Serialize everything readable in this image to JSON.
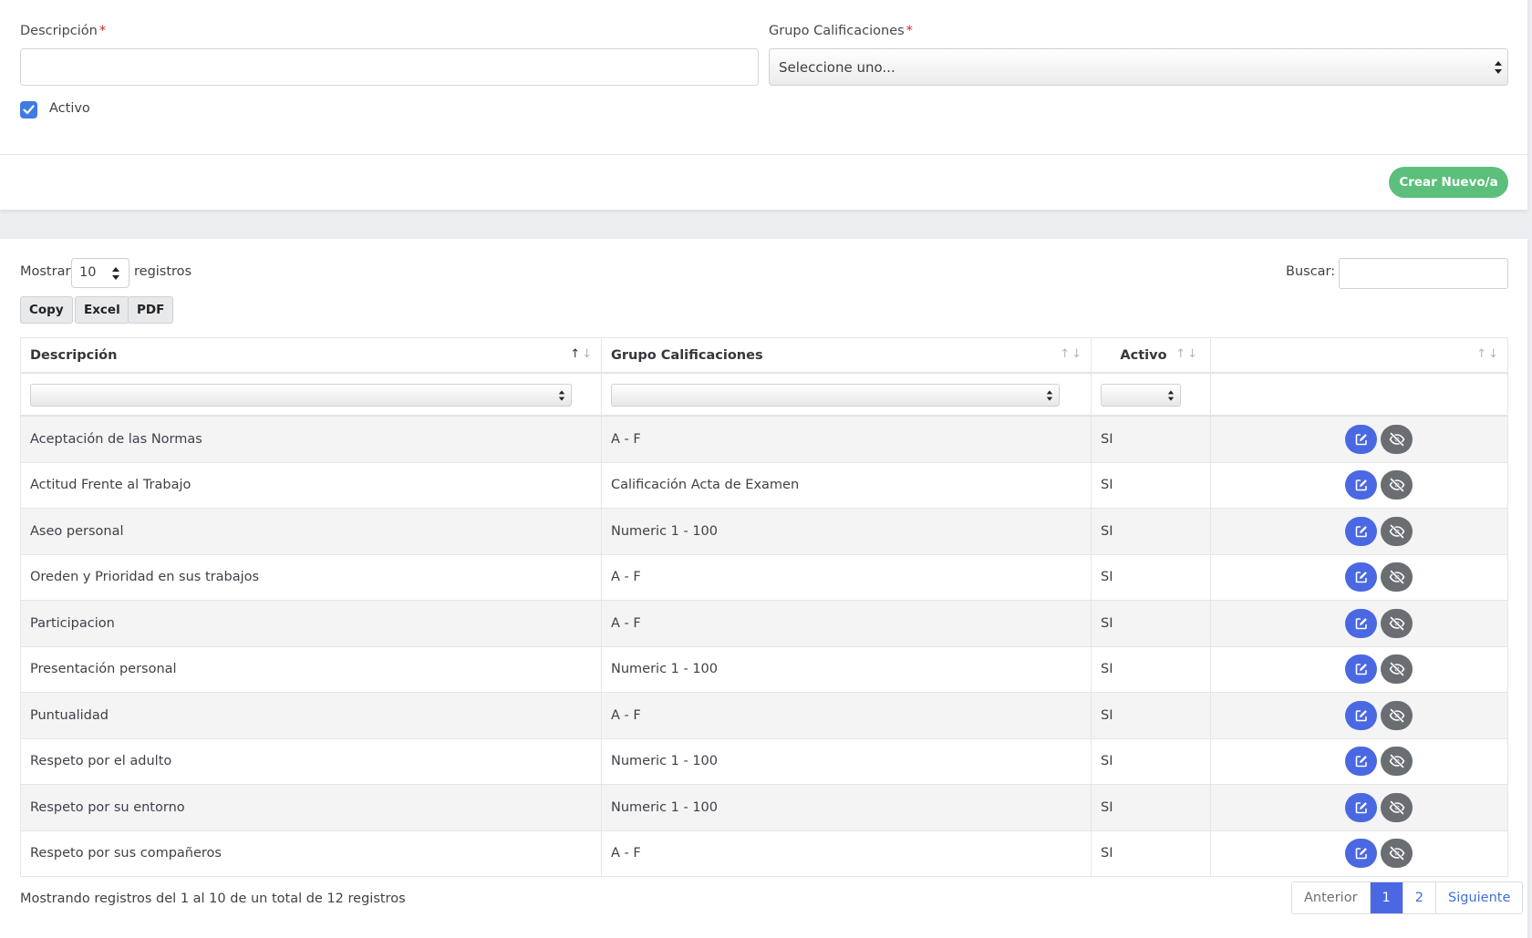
{
  "form": {
    "descripcion_label": "Descripción",
    "grupo_label": "Grupo Calificaciones",
    "required_mark": "*",
    "descripcion_value": "",
    "grupo_selected": "Seleccione uno...",
    "activo_label": "Activo",
    "activo_checked": true,
    "create_button": "Crear Nuevo/a"
  },
  "controls": {
    "show_label": "Mostrar",
    "page_length": "10",
    "records_label": "registros",
    "search_label": "Buscar:",
    "search_value": "",
    "export_buttons": [
      "Copy",
      "Excel",
      "PDF"
    ]
  },
  "table": {
    "columns": [
      "Descripción",
      "Grupo Calificaciones",
      "Activo",
      ""
    ],
    "rows": [
      {
        "descripcion": "Aceptación de las Normas",
        "grupo": "A - F",
        "activo": "SI"
      },
      {
        "descripcion": "Actitud Frente al Trabajo",
        "grupo": "Calificación Acta de Examen",
        "activo": "SI"
      },
      {
        "descripcion": "Aseo personal",
        "grupo": "Numeric 1 - 100",
        "activo": "SI"
      },
      {
        "descripcion": "Oreden y Prioridad en sus trabajos",
        "grupo": "A - F",
        "activo": "SI"
      },
      {
        "descripcion": "Participacion",
        "grupo": "A - F",
        "activo": "SI"
      },
      {
        "descripcion": "Presentación personal",
        "grupo": "Numeric 1 - 100",
        "activo": "SI"
      },
      {
        "descripcion": "Puntualidad",
        "grupo": "A - F",
        "activo": "SI"
      },
      {
        "descripcion": "Respeto por el adulto",
        "grupo": "Numeric 1 - 100",
        "activo": "SI"
      },
      {
        "descripcion": "Respeto por su entorno",
        "grupo": "Numeric 1 - 100",
        "activo": "SI"
      },
      {
        "descripcion": "Respeto por sus compañeros",
        "grupo": "A - F",
        "activo": "SI"
      }
    ]
  },
  "footer": {
    "info": "Mostrando registros del 1 al 10 de un total de 12 registros",
    "pager": {
      "prev": "Anterior",
      "pages": [
        "1",
        "2"
      ],
      "current": "1",
      "next": "Siguiente"
    }
  },
  "colors": {
    "primary": "#4b68e3",
    "success": "#5cbf7b",
    "secondary": "#6a6d71",
    "checkbox": "#3f7be0"
  },
  "icons": {
    "edit": "edit-icon",
    "hide": "eye-slash-icon",
    "sort": "sort-arrows-icon",
    "check": "check-icon"
  }
}
